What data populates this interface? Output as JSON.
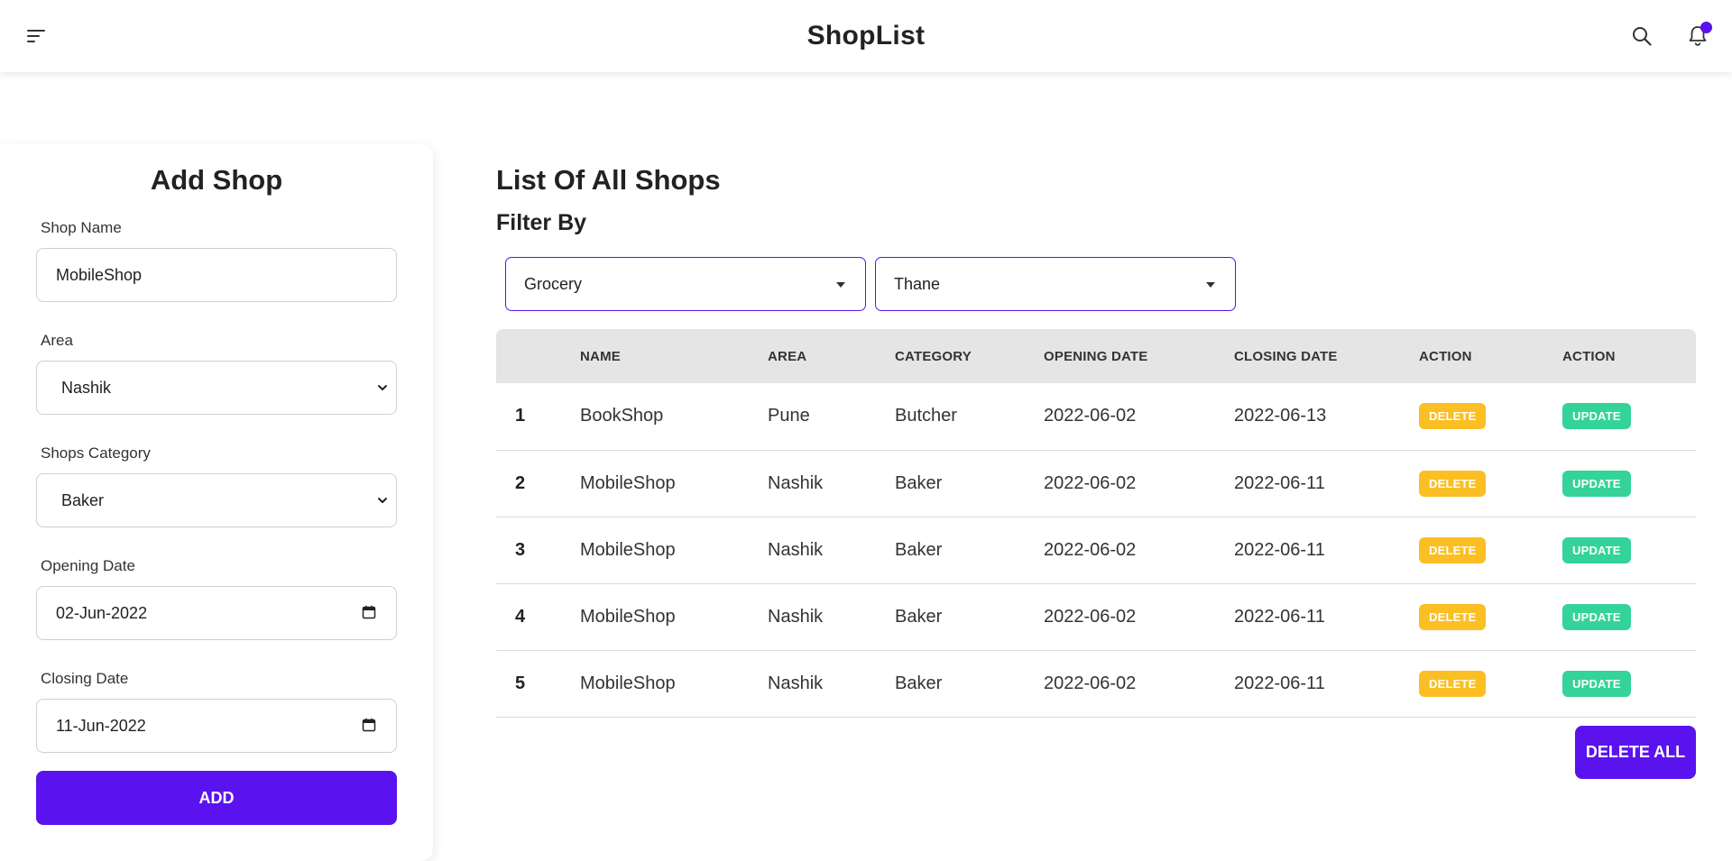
{
  "header": {
    "title": "ShopList",
    "accent_color": "#5a12ef"
  },
  "add_shop": {
    "title": "Add Shop",
    "shop_name_label": "Shop Name",
    "shop_name_value": "MobileShop",
    "area_label": "Area",
    "area_value": "Nashik",
    "category_label": "Shops Category",
    "category_value": "Baker",
    "opening_label": "Opening Date",
    "opening_value": "02-Jun-2022",
    "closing_label": "Closing Date",
    "closing_value": "11-Jun-2022",
    "add_label": "ADD"
  },
  "list": {
    "title": "List Of All Shops",
    "filter_title": "Filter By",
    "filter_category": "Grocery",
    "filter_area": "Thane",
    "columns": [
      "",
      "NAME",
      "AREA",
      "CATEGORY",
      "OPENING DATE",
      "CLOSING DATE",
      "ACTION",
      "ACTION"
    ],
    "rows": [
      {
        "idx": "1",
        "name": "BookShop",
        "area": "Pune",
        "category": "Butcher",
        "opening": "2022-06-02",
        "closing": "2022-06-13"
      },
      {
        "idx": "2",
        "name": "MobileShop",
        "area": "Nashik",
        "category": "Baker",
        "opening": "2022-06-02",
        "closing": "2022-06-11"
      },
      {
        "idx": "3",
        "name": "MobileShop",
        "area": "Nashik",
        "category": "Baker",
        "opening": "2022-06-02",
        "closing": "2022-06-11"
      },
      {
        "idx": "4",
        "name": "MobileShop",
        "area": "Nashik",
        "category": "Baker",
        "opening": "2022-06-02",
        "closing": "2022-06-11"
      },
      {
        "idx": "5",
        "name": "MobileShop",
        "area": "Nashik",
        "category": "Baker",
        "opening": "2022-06-02",
        "closing": "2022-06-11"
      }
    ],
    "delete_label": "DELETE",
    "update_label": "UPDATE",
    "delete_all_label": "DELETE ALL"
  },
  "icons": {
    "menu": "menu-icon",
    "search": "search-icon",
    "notifications": "bell-icon",
    "dropdown": "chevron-down-icon",
    "calendar": "calendar-icon"
  }
}
